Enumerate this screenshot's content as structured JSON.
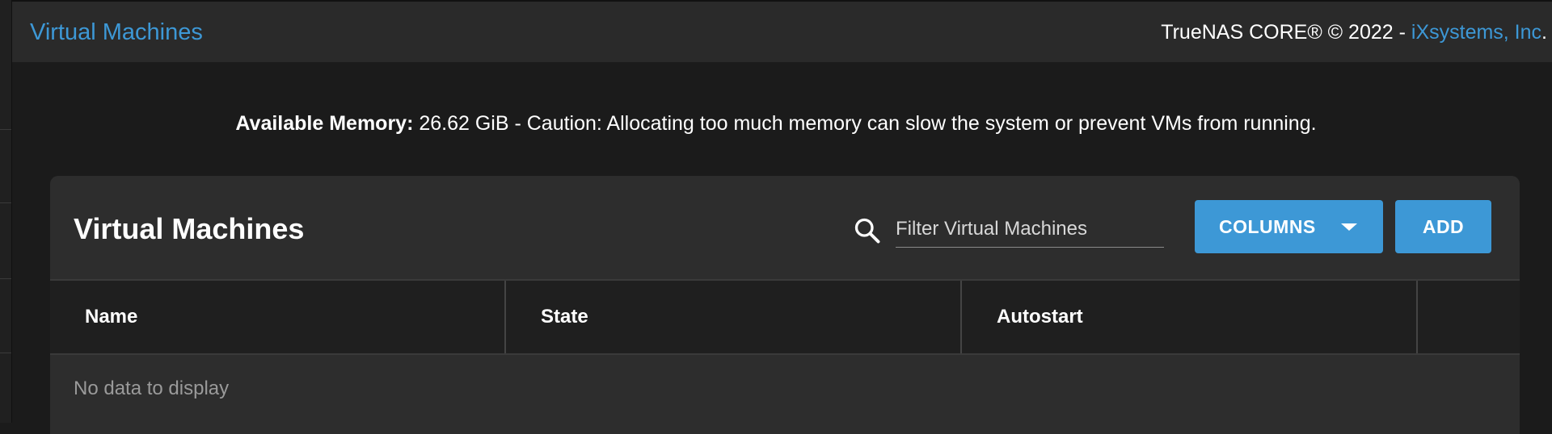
{
  "header": {
    "title": "Virtual Machines",
    "copyright_prefix": "TrueNAS CORE® © 2022 - ",
    "company": "iXsystems, Inc",
    "copyright_suffix": "."
  },
  "memory_notice": {
    "label": "Available Memory:",
    "text": " 26.62 GiB - Caution: Allocating too much memory can slow the system or prevent VMs from running."
  },
  "card": {
    "title": "Virtual Machines",
    "search": {
      "placeholder": "Filter Virtual Machines",
      "value": ""
    },
    "columns_button": "COLUMNS",
    "add_button": "ADD"
  },
  "table": {
    "columns": [
      "Name",
      "State",
      "Autostart",
      ""
    ],
    "empty_message": "No data to display"
  },
  "colors": {
    "accent": "#3d98d6",
    "background": "#1b1b1b",
    "card": "#2d2d2d"
  }
}
